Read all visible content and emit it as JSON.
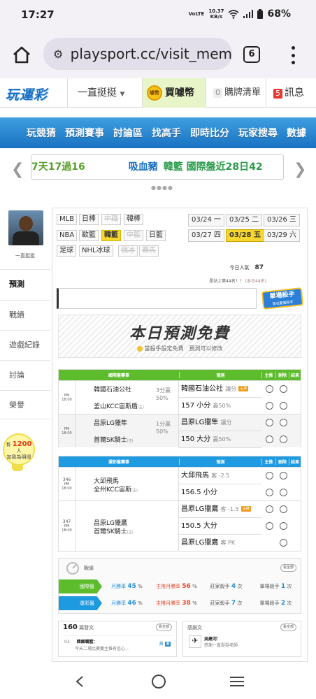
{
  "status": {
    "time": "17:27",
    "network": "VoLTE",
    "speed_value": "10.37",
    "speed_unit": "KB/s",
    "battery": "68%"
  },
  "browser": {
    "url": "playsport.cc/visit_mem",
    "tab_count": "6"
  },
  "site": {
    "logo": "玩運彩",
    "user_dropdown": "一直挺挺",
    "buy_coin": "買噱幣",
    "coin_label": "噱幣",
    "cart_count": "0",
    "cart_label": "購牌清單",
    "msg_count": "5",
    "msg_label": "訊息"
  },
  "nav": [
    "玩競猜",
    "預測賽事",
    "討論區",
    "找高手",
    "即時比分",
    "玩家搜尋",
    "數據"
  ],
  "ticker": {
    "t1": "7天17過16",
    "t2": "吸血豬",
    "t3": "韓籃 國際盤近28日42"
  },
  "sidebar": {
    "username": "一直挺挺",
    "items": [
      "預測",
      "戰績",
      "遊戲紀錄",
      "討論",
      "榮譽"
    ],
    "bulb_prefix": "有",
    "bulb_count": "1200",
    "bulb_unit": "人",
    "bulb_text": "加我為明燈"
  },
  "leagues": {
    "row1": [
      "MLB",
      "日棒",
      "中職",
      "韓棒"
    ],
    "row2": [
      "NBA",
      "歐籃",
      "韓籃",
      "中籃",
      "日籃"
    ],
    "row3": [
      "足球",
      "NHL冰球",
      "俄冰",
      "賽馬"
    ]
  },
  "dates": [
    "03/24 一",
    "03/25 二",
    "03/26 三",
    "03/27 四",
    "03/28 五",
    "03/29 六"
  ],
  "popularity": {
    "label": "今日人氣",
    "value": "87"
  },
  "rank": {
    "text": "是站上第44名！！",
    "note": "(本日44名)"
  },
  "killer": {
    "title": "單場殺手",
    "sub": "我也要當殺手"
  },
  "banner": {
    "title": "本日預測免費",
    "sub": "當殺手設定免費　預測可以修改"
  },
  "intl": {
    "header": [
      "國際盤賽事",
      "預測",
      "主推",
      "刪除",
      "結果"
    ],
    "games": [
      {
        "time": "PM 18:00",
        "home": "韓國石油公社",
        "away": "釜山KCC宙斯盾",
        "away_tag": "(主)",
        "spread": "3分贏",
        "pct": "50%",
        "pick1": "韓國石油公社",
        "pick1_note": "讓分",
        "pick1_tag": "主推",
        "pick2": "157 小分",
        "pick2_note": "贏50%"
      },
      {
        "time": "PM 18:00",
        "home": "昌原LG獵隼",
        "away": "首爾SK騎士",
        "away_tag": "(主)",
        "spread": "1分贏",
        "pct": "50%",
        "pick1": "昌原LG獵隼",
        "pick1_note": "讓分",
        "pick2": "150 大分",
        "pick2_note": "贏50%"
      }
    ]
  },
  "lottery": {
    "header": [
      "運彩盤賽事",
      "預測",
      "主推",
      "刪除",
      "結果"
    ],
    "games": [
      {
        "num": "346",
        "time": "PM 18:00",
        "home": "大邱飛馬",
        "away": "全州KCC宙斯",
        "away_tag": "(主)",
        "picks": [
          "大邱飛馬",
          "156.5 小分"
        ],
        "pick_notes": [
          "客 -2.5",
          ""
        ]
      },
      {
        "num": "347",
        "time": "PM 18:00",
        "home": "昌原LG獵鷹",
        "away": "首爾SK騎士",
        "away_tag": "(主)",
        "picks": [
          "昌原LG獵鷹",
          "150.5 大分",
          "昌原LG獵鷹"
        ],
        "pick_notes": [
          "客 -1.5",
          "",
          "客 PK"
        ],
        "pick_tag": "主推"
      }
    ]
  },
  "stats": {
    "title": "戰績",
    "more": "看全部",
    "rows": [
      {
        "label": "國際盤",
        "c1_label": "月勝率",
        "c1_value": "45",
        "c2_label": "主推月勝率",
        "c2_value": "56",
        "c3_label": "莊家殺手",
        "c3_value": "4",
        "c4_label": "單場殺手",
        "c4_value": "1",
        "unit_pct": "%",
        "unit_times": "次"
      },
      {
        "label": "運彩盤",
        "c1_label": "月勝率",
        "c1_value": "46",
        "c2_label": "主推月勝率",
        "c2_value": "38",
        "c3_label": "莊家殺手",
        "c3_value": "7",
        "c4_label": "單場殺手",
        "c4_value": "2",
        "unit_pct": "%",
        "unit_times": "次"
      }
    ]
  },
  "articles": {
    "count": "160",
    "label": "篇發文",
    "more": "看全部",
    "date": "03",
    "title": "韓國職籃：",
    "snippet": "今天二場比賽雙主推有信心…",
    "badge_prefix": "推",
    "badge_count": "8"
  },
  "thanks": {
    "label": "感謝文",
    "more": "看全部",
    "name": "吳建河：",
    "snippet": "感謝一直挺挺老師"
  }
}
